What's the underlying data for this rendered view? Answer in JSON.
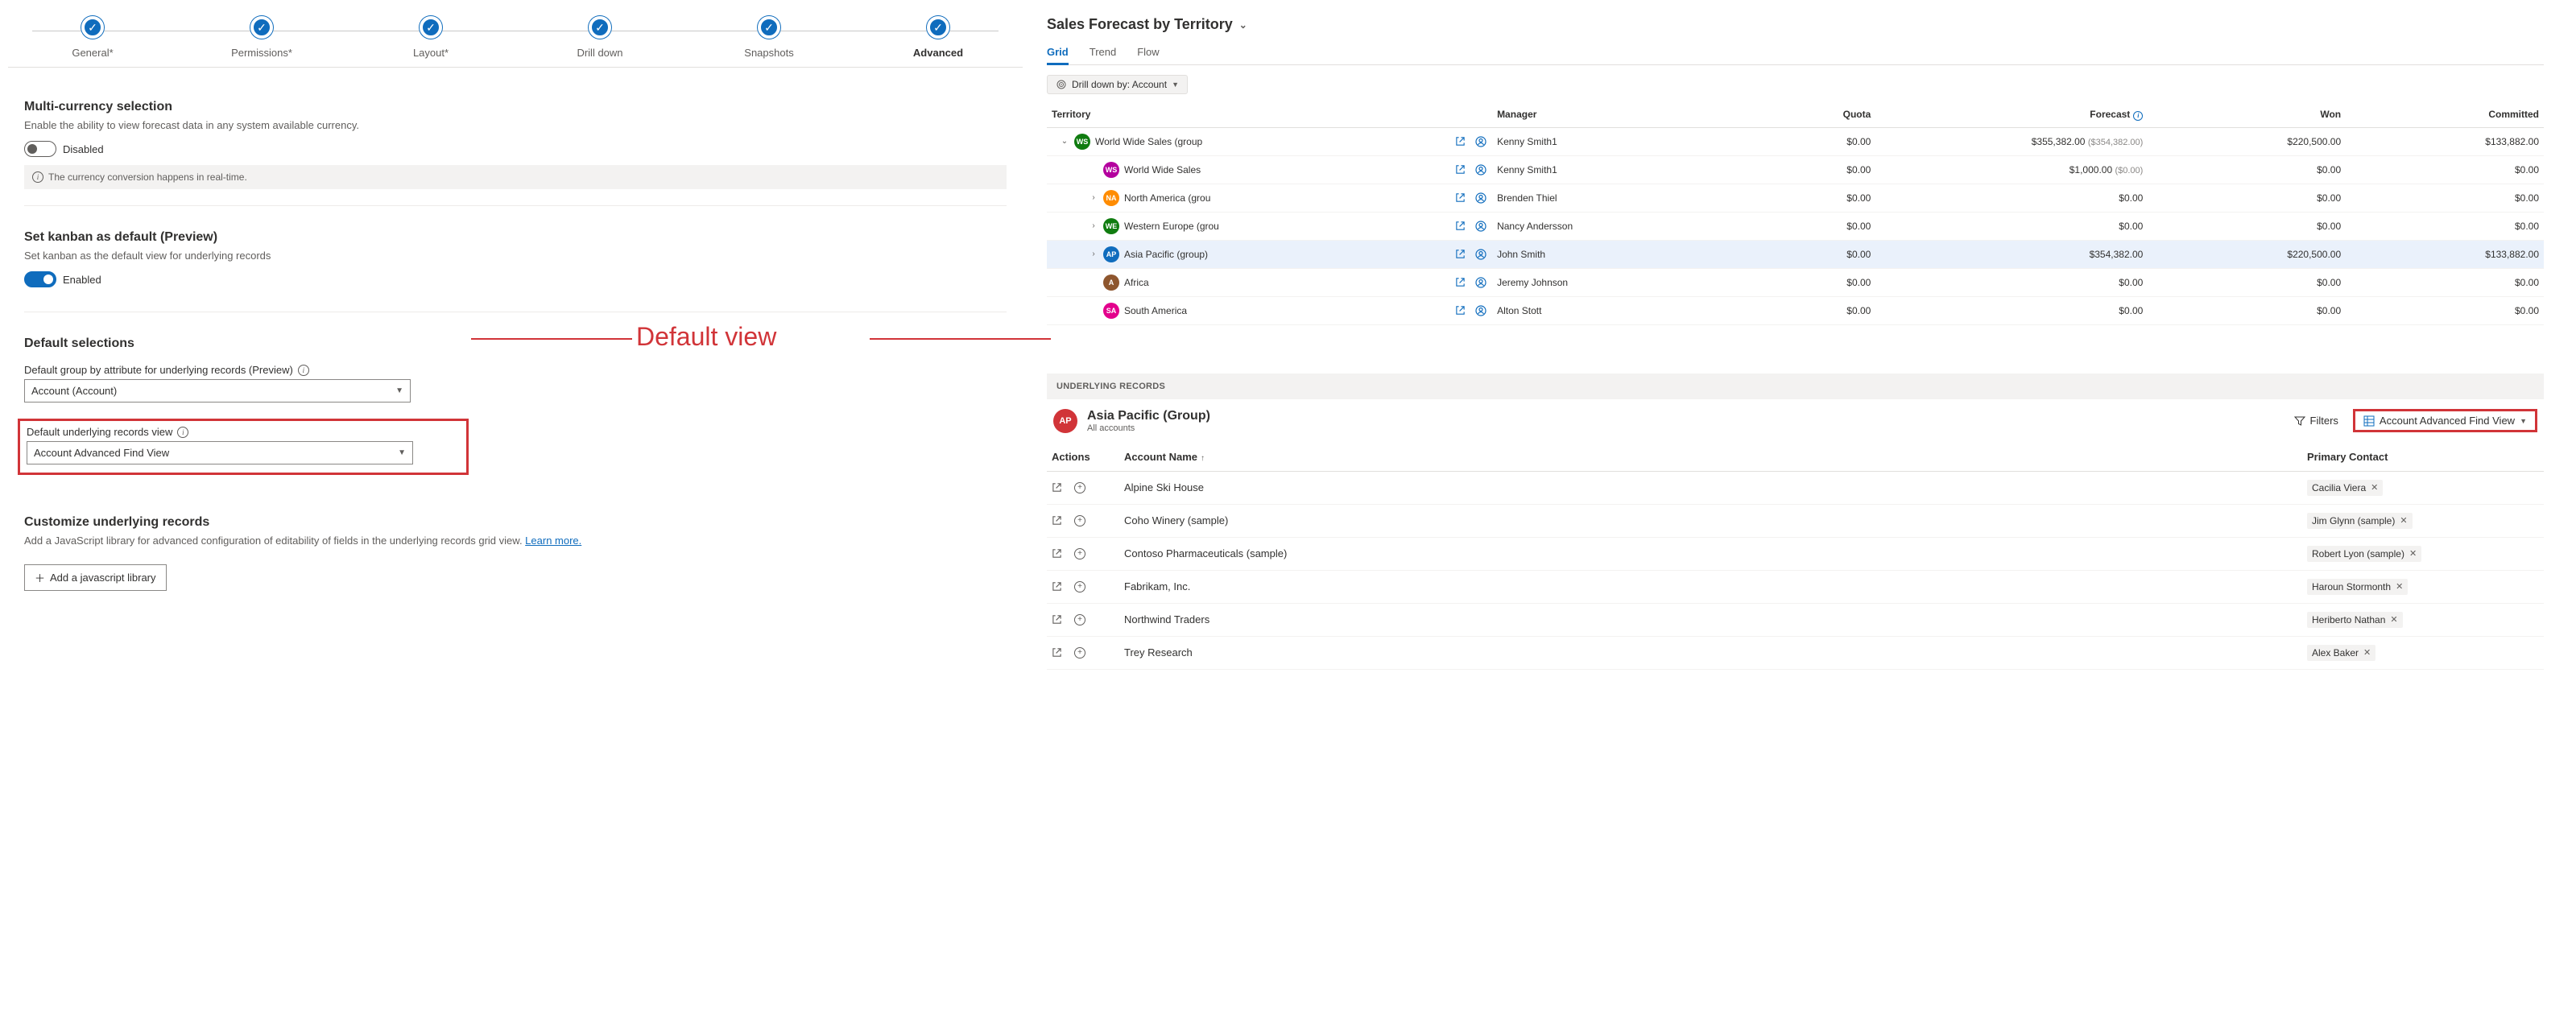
{
  "steps": [
    "General*",
    "Permissions*",
    "Layout*",
    "Drill down",
    "Snapshots",
    "Advanced"
  ],
  "active_step": 5,
  "multi_currency": {
    "title": "Multi-currency selection",
    "desc": "Enable the ability to view forecast data in any system available currency.",
    "toggle_label": "Disabled",
    "banner": "The currency conversion happens in real-time."
  },
  "kanban": {
    "title": "Set kanban as default (Preview)",
    "desc": "Set kanban as the default view for underlying records",
    "toggle_label": "Enabled"
  },
  "defaults": {
    "title": "Default selections",
    "group_label": "Default group by attribute for underlying records (Preview)",
    "group_value": "Account (Account)",
    "view_label": "Default underlying records view",
    "view_value": "Account Advanced Find View"
  },
  "customize": {
    "title": "Customize underlying records",
    "desc_a": "Add a JavaScript library for advanced configuration of editability of fields in the underlying records grid view. ",
    "desc_link": "Learn more.",
    "button": "Add a javascript library"
  },
  "annotation_text": "Default view",
  "forecast": {
    "title": "Sales Forecast by Territory",
    "tabs": [
      "Grid",
      "Trend",
      "Flow"
    ],
    "active_tab": 0,
    "drill_label": "Drill down by: Account",
    "columns": [
      "Territory",
      "",
      "Manager",
      "Quota",
      "Forecast",
      "Won",
      "Committed"
    ],
    "rows": [
      {
        "indent": 0,
        "chev": "down",
        "badge": "WS",
        "color": "#107c10",
        "name": "World Wide Sales (group",
        "manager": "Kenny Smith1",
        "quota": "$0.00",
        "forecast": "$355,382.00",
        "fsub": "($354,382.00)",
        "won": "$220,500.00",
        "committed": "$133,882.00",
        "hl": false
      },
      {
        "indent": 1,
        "chev": "",
        "badge": "WS",
        "color": "#b4009e",
        "name": "World Wide Sales",
        "manager": "Kenny Smith1",
        "quota": "$0.00",
        "forecast": "$1,000.00",
        "fsub": "($0.00)",
        "won": "$0.00",
        "committed": "$0.00",
        "hl": false
      },
      {
        "indent": 1,
        "chev": "right",
        "badge": "NA",
        "color": "#ff8c00",
        "name": "North America (grou",
        "manager": "Brenden Thiel",
        "quota": "$0.00",
        "forecast": "$0.00",
        "fsub": "",
        "won": "$0.00",
        "committed": "$0.00",
        "hl": false
      },
      {
        "indent": 1,
        "chev": "right",
        "badge": "WE",
        "color": "#107c10",
        "name": "Western Europe (grou",
        "manager": "Nancy Andersson",
        "quota": "$0.00",
        "forecast": "$0.00",
        "fsub": "",
        "won": "$0.00",
        "committed": "$0.00",
        "hl": false
      },
      {
        "indent": 1,
        "chev": "right",
        "badge": "AP",
        "color": "#0f6cbd",
        "name": "Asia Pacific (group)",
        "manager": "John Smith",
        "quota": "$0.00",
        "forecast": "$354,382.00",
        "fsub": "",
        "won": "$220,500.00",
        "committed": "$133,882.00",
        "hl": true
      },
      {
        "indent": 1,
        "chev": "",
        "badge": "A",
        "color": "#8e562e",
        "name": "Africa",
        "manager": "Jeremy Johnson",
        "quota": "$0.00",
        "forecast": "$0.00",
        "fsub": "",
        "won": "$0.00",
        "committed": "$0.00",
        "hl": false
      },
      {
        "indent": 1,
        "chev": "",
        "badge": "SA",
        "color": "#e3008c",
        "name": "South America",
        "manager": "Alton Stott",
        "quota": "$0.00",
        "forecast": "$0.00",
        "fsub": "",
        "won": "$0.00",
        "committed": "$0.00",
        "hl": false
      }
    ]
  },
  "underlying": {
    "bar": "UNDERLYING RECORDS",
    "title": "Asia Pacific (Group)",
    "sub": "All accounts",
    "badge": "AP",
    "filters": "Filters",
    "view": "Account Advanced Find View",
    "columns": {
      "actions": "Actions",
      "name": "Account Name",
      "contact": "Primary Contact"
    },
    "rows": [
      {
        "name": "Alpine Ski House",
        "contact": "Cacilia Viera"
      },
      {
        "name": "Coho Winery (sample)",
        "contact": "Jim Glynn (sample)"
      },
      {
        "name": "Contoso Pharmaceuticals (sample)",
        "contact": "Robert Lyon (sample)"
      },
      {
        "name": "Fabrikam, Inc.",
        "contact": "Haroun Stormonth"
      },
      {
        "name": "Northwind Traders",
        "contact": "Heriberto Nathan"
      },
      {
        "name": "Trey Research",
        "contact": "Alex Baker"
      }
    ]
  }
}
